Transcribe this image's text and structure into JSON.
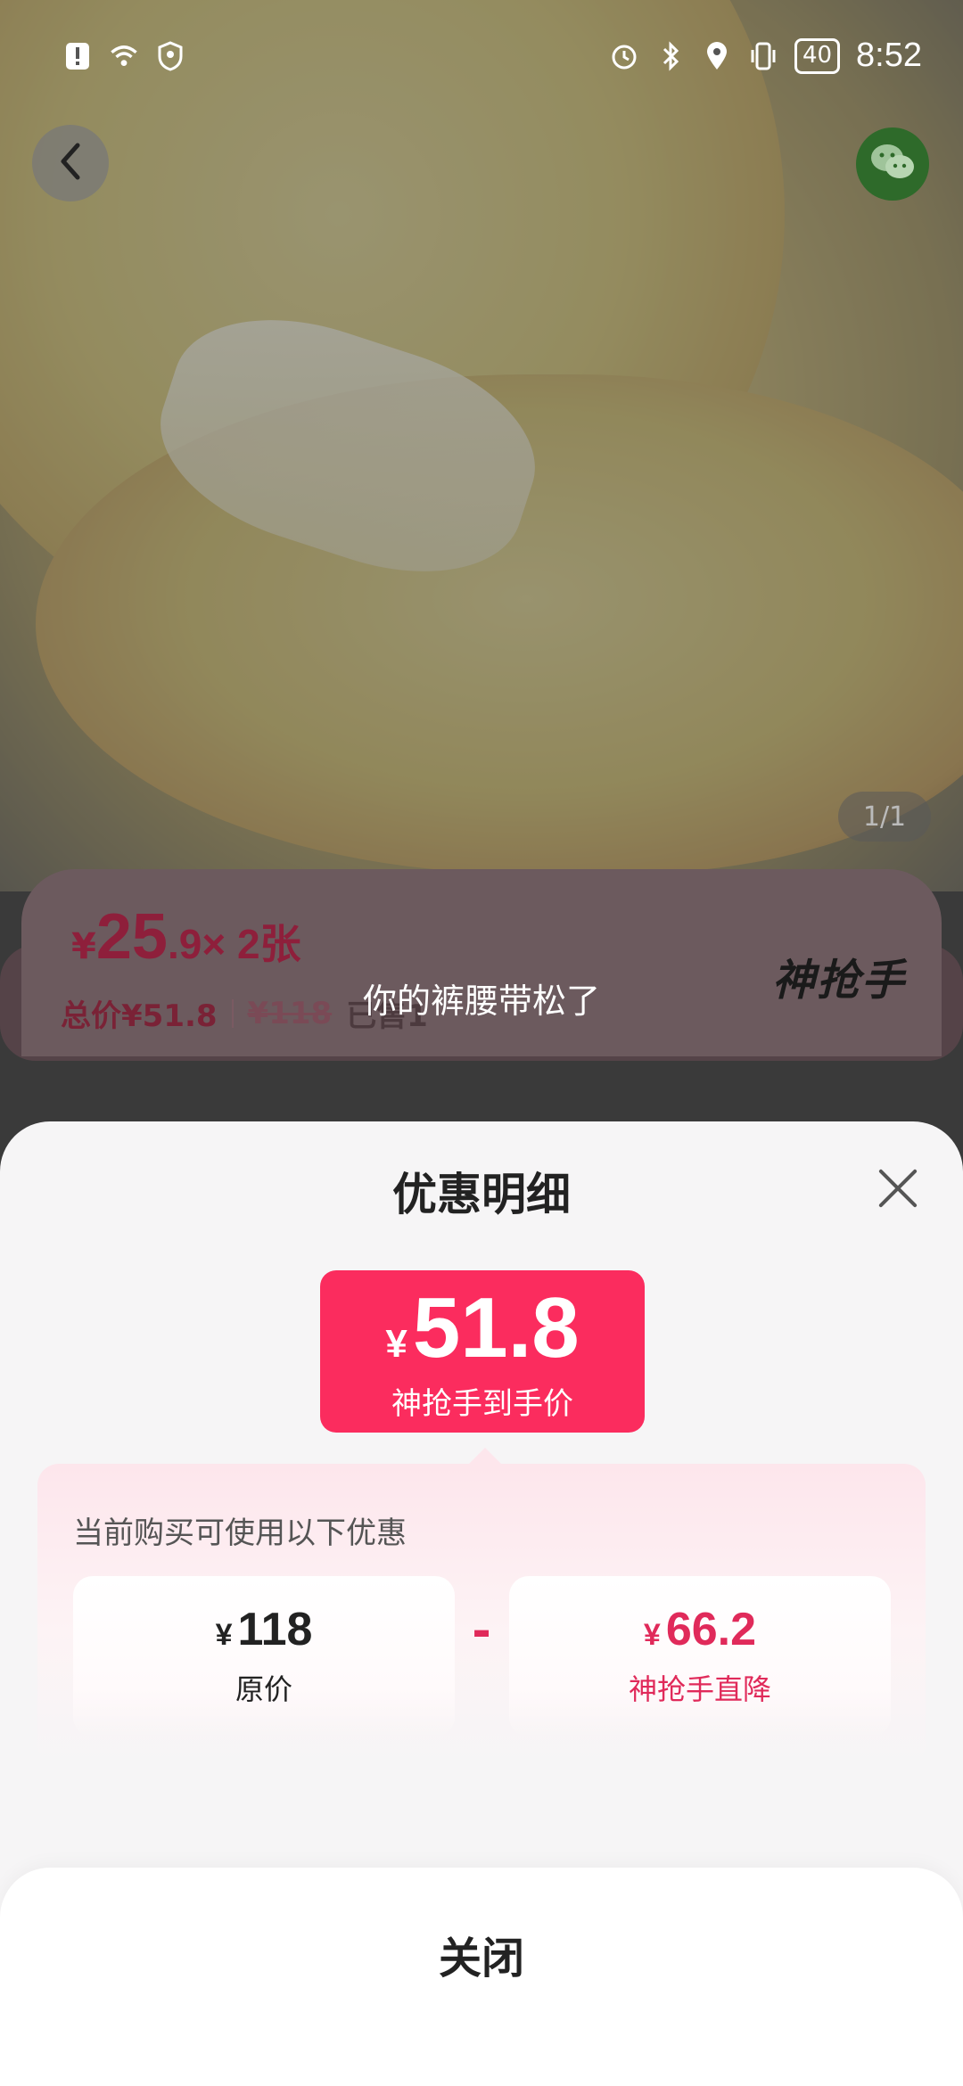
{
  "status_bar": {
    "time": "8:52",
    "battery": "40",
    "icons_left": [
      "alert-icon",
      "wifi-icon",
      "vpn-shield-icon"
    ],
    "icons_right": [
      "alarm-icon",
      "bluetooth-icon",
      "location-icon",
      "vibrate-icon",
      "battery-icon"
    ]
  },
  "gallery": {
    "page_indicator": "1/1"
  },
  "price_card": {
    "yen": "¥",
    "unit_price_int": "25",
    "unit_price_dec": ".9",
    "quantity": "× 2张",
    "total_label": "总价¥51.8",
    "original_price": "¥118",
    "sold_text": "已售1",
    "brand": "神抢手"
  },
  "toast": "你的裤腰带松了",
  "sheet": {
    "title": "优惠明细",
    "final_price": {
      "yen": "¥",
      "amount": "51.8",
      "label": "神抢手到手价"
    },
    "discount_intro": "当前购买可使用以下优惠",
    "original": {
      "yen": "¥",
      "amount": "118",
      "label": "原价"
    },
    "operator": "-",
    "cut": {
      "yen": "¥",
      "amount": "66.2",
      "label": "神抢手直降"
    },
    "close_label": "关闭"
  },
  "colors": {
    "accent": "#fb2c5e",
    "accent_text": "#e02a5a",
    "wechat": "#2e6a2a"
  }
}
